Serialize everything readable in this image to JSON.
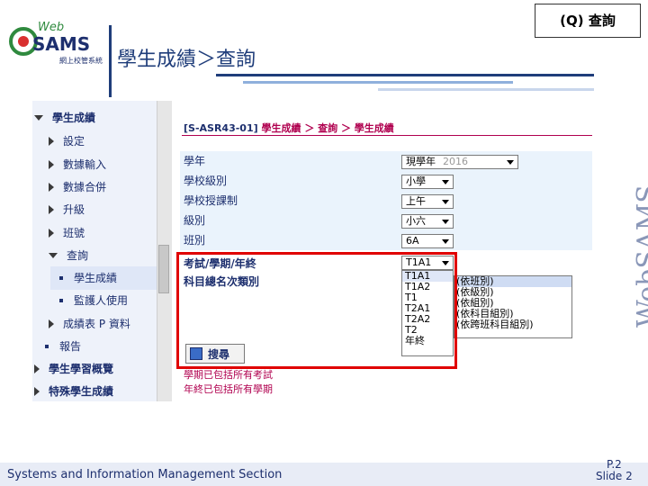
{
  "header": {
    "logo_text_top": "Web",
    "logo_text_main": "SAMS",
    "logo_text_sub": "網上校管系統",
    "slide_title": "學生成績＞查詢",
    "top_right_label": "(Q) 查詢"
  },
  "sidebar": {
    "items": [
      {
        "label": "學生成績",
        "level": 0,
        "marker": "tridown"
      },
      {
        "label": "設定",
        "level": 1,
        "marker": "tri"
      },
      {
        "label": "數據輸入",
        "level": 1,
        "marker": "tri"
      },
      {
        "label": "數據合併",
        "level": 1,
        "marker": "tri"
      },
      {
        "label": "升級",
        "level": 1,
        "marker": "tri"
      },
      {
        "label": "班號",
        "level": 1,
        "marker": "tri"
      },
      {
        "label": "查詢",
        "level": 1,
        "marker": "tridown"
      },
      {
        "label": "學生成績",
        "level": 2,
        "marker": "sq"
      },
      {
        "label": "監護人使用",
        "level": 2,
        "marker": "sq"
      },
      {
        "label": "成績表 P 資料",
        "level": 1,
        "marker": "tri"
      },
      {
        "label": "報告",
        "level": 1,
        "marker": "sq"
      },
      {
        "label": "學生學習概覽",
        "level": 0,
        "marker": "tri"
      },
      {
        "label": "特殊學生成績",
        "level": 0,
        "marker": "tri"
      }
    ]
  },
  "breadcrumb": {
    "code": "[S-ASR43-01]",
    "path": "學生成績 ＞ 查詢 ＞ 學生成績"
  },
  "form": {
    "school_year": {
      "label": "學年",
      "value": "現學年",
      "year": "2016"
    },
    "school_level": {
      "label": "學校級別",
      "value": "小學"
    },
    "session": {
      "label": "學校授課制",
      "value": "上午"
    },
    "level": {
      "label": "級別",
      "value": "小六"
    },
    "class": {
      "label": "班別",
      "value": "6A"
    },
    "exam_term": {
      "label": "考試/學期/年終",
      "value": "T1A1",
      "options": [
        "T1A1",
        "T1A2",
        "T1",
        "T2A1",
        "T2A2",
        "T2",
        "年終"
      ]
    },
    "rank_type": {
      "label": "科目總名次類別",
      "options": [
        "(依班別)",
        "(依級別)",
        "(依組別)",
        "(依科目組別)",
        "(依跨班科目組別)"
      ]
    }
  },
  "search_button": {
    "label": "搜尋"
  },
  "notes": [
    "學期已包括所有考試",
    "年終已包括所有學期"
  ],
  "footer": {
    "section": "Systems and Information Management Section",
    "page": "P.2",
    "slide": "Slide 2",
    "watermark": "WebSAMS"
  },
  "colors": {
    "accent_navy": "#1d2f6e",
    "alert_red": "#e00000",
    "pink": "#b0004f"
  }
}
